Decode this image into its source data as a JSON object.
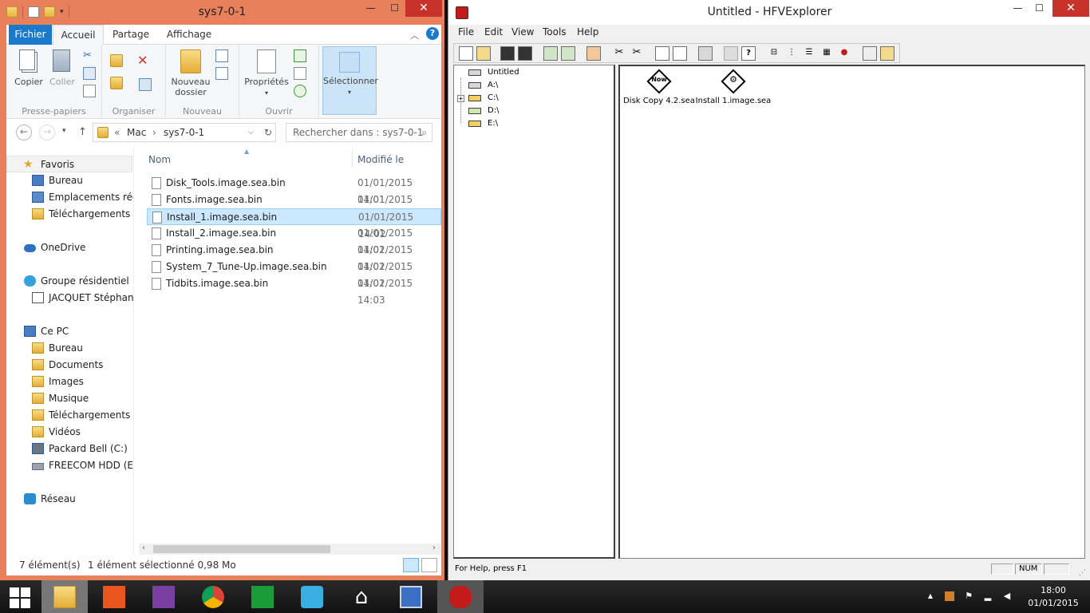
{
  "explorer": {
    "title": "sys7-0-1",
    "controls": {
      "minimize": "—",
      "maximize": "☐",
      "close": "✕"
    },
    "ribbon_tabs": [
      "Fichier",
      "Accueil",
      "Partage",
      "Affichage"
    ],
    "ribbon": {
      "copy": "Copier",
      "paste": "Coller",
      "group_clipboard": "Presse-papiers",
      "group_organize": "Organiser",
      "new_folder_line1": "Nouveau",
      "new_folder_line2": "dossier",
      "group_new": "Nouveau",
      "properties": "Propriétés",
      "group_open": "Ouvrir",
      "select": "Sélectionner"
    },
    "address": {
      "chevrons": "«",
      "crumbs": [
        "Mac",
        "sys7-0-1"
      ],
      "separator": "›",
      "search_placeholder": "Rechercher dans : sys7-0-1"
    },
    "nav": {
      "favorites": "Favoris",
      "fav_items": [
        "Bureau",
        "Emplacements récen",
        "Téléchargements"
      ],
      "onedrive": "OneDrive",
      "homegroup": "Groupe résidentiel",
      "user": "JACQUET Stéphanie",
      "this_pc": "Ce PC",
      "pc_items": [
        "Bureau",
        "Documents",
        "Images",
        "Musique",
        "Téléchargements",
        "Vidéos",
        "Packard Bell (C:)",
        "FREECOM HDD (E:)"
      ],
      "network": "Réseau"
    },
    "columns": {
      "name": "Nom",
      "modified": "Modifié le"
    },
    "files": [
      {
        "name": "Disk_Tools.image.sea.bin",
        "date": "01/01/2015 14:01"
      },
      {
        "name": "Fonts.image.sea.bin",
        "date": "01/01/2015 14:02"
      },
      {
        "name": "Install_1.image.sea.bin",
        "date": "01/01/2015 14:02"
      },
      {
        "name": "Install_2.image.sea.bin",
        "date": "01/01/2015 14:02"
      },
      {
        "name": "Printing.image.sea.bin",
        "date": "01/01/2015 14:02"
      },
      {
        "name": "System_7_Tune-Up.image.sea.bin",
        "date": "01/01/2015 14:02"
      },
      {
        "name": "Tidbits.image.sea.bin",
        "date": "01/01/2015 14:03"
      }
    ],
    "selected_index": 2,
    "status": {
      "count": "7 élément(s)",
      "selection": "1 élément sélectionné  0,98 Mo"
    }
  },
  "hfv": {
    "title": "Untitled - HFVExplorer",
    "controls": {
      "minimize": "—",
      "maximize": "☐",
      "close": "✕"
    },
    "menu": [
      "File",
      "Edit",
      "View",
      "Tools",
      "Help"
    ],
    "tree": [
      "Untitled",
      "A:\\",
      "C:\\",
      "D:\\",
      "E:\\"
    ],
    "tree_plus": "+",
    "icons": [
      {
        "label": "Disk Copy 4.2.sea",
        "glyph": "Now"
      },
      {
        "label": "Install 1.image.sea",
        "glyph": "⚙"
      }
    ],
    "status_help": "For Help, press F1",
    "status_num": "NUM"
  },
  "taskbar": {
    "time": "18:00",
    "date": "01/01/2015",
    "tray_arrow": "▲"
  },
  "colors": {
    "explorer_frame": "#e9805c",
    "accent_blue": "#1979ca",
    "close_red": "#c7322b",
    "selection": "#cce8ff"
  }
}
